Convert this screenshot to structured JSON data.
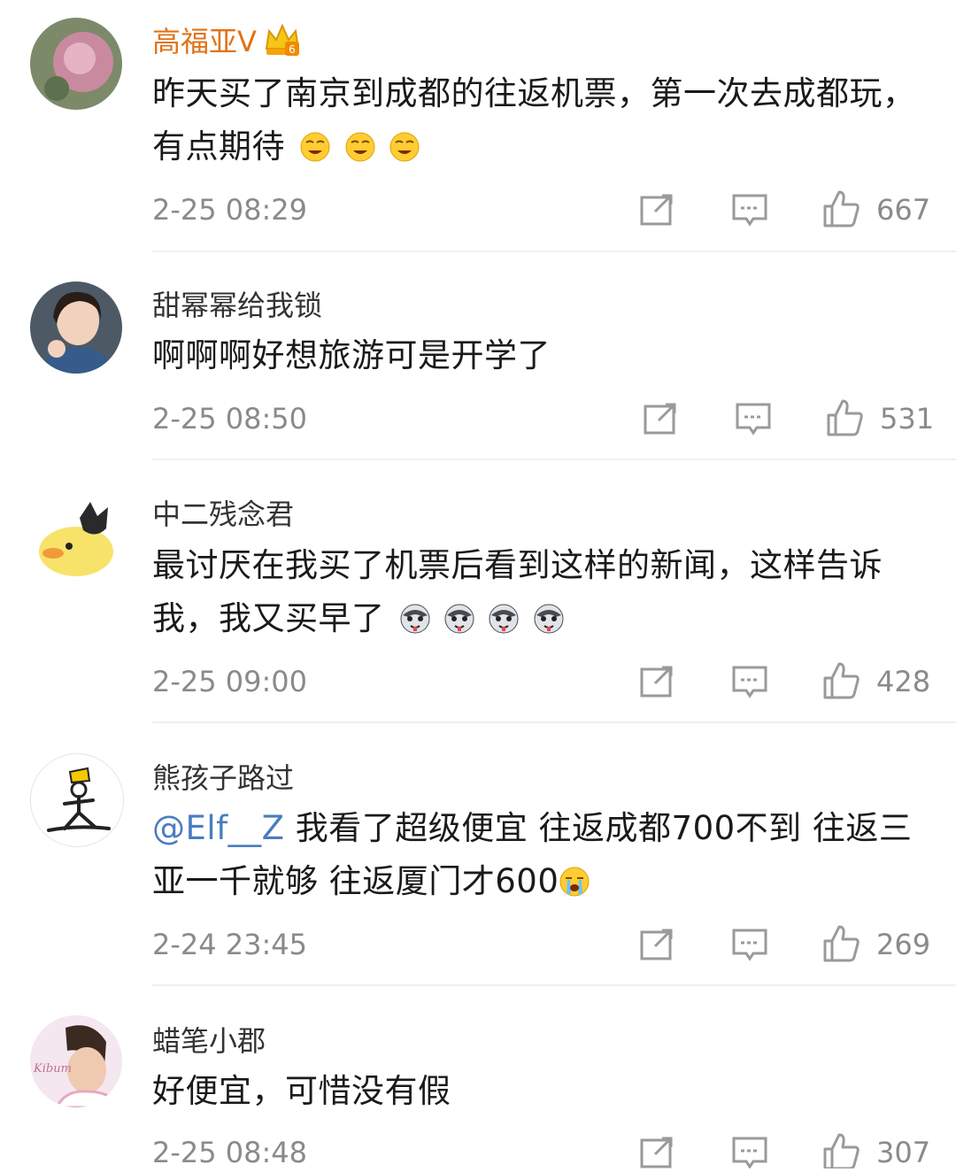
{
  "comments": [
    {
      "username": "高福亚V",
      "vip": true,
      "vip_badge_level": "6",
      "text": "昨天买了南京到成都的往返机票，第一次去成都玩，有点期待",
      "emoji": {
        "name": "smirk-emoji",
        "count": 3
      },
      "time": "2-25 08:29",
      "likes": "667"
    },
    {
      "username": "甜幂幂给我锁",
      "text": "啊啊啊好想旅游可是开学了",
      "time": "2-25 08:50",
      "likes": "531"
    },
    {
      "username": "中二残念君",
      "text": "最讨厌在我买了机票后看到这样的新闻，这样告诉我，我又买早了",
      "emoji": {
        "name": "husky-emoji",
        "count": 4
      },
      "time": "2-25 09:00",
      "likes": "428"
    },
    {
      "username": "熊孩子路过",
      "mention": "@Elf__Z",
      "text": " 我看了超级便宜 往返成都700不到 往返三亚一千就够 往返厦门才600",
      "emoji": {
        "name": "crying-emoji",
        "count": 1
      },
      "time": "2-24 23:45",
      "likes": "269"
    },
    {
      "username": "蜡笔小郡",
      "avatar_text": "Kibum",
      "text": "好便宜，可惜没有假",
      "time": "2-25 08:48",
      "likes": "307"
    }
  ],
  "icons": {
    "repost": "repost-icon",
    "comment": "comment-icon",
    "like": "thumbs-up-icon"
  },
  "colors": {
    "vip_name": "#e0731a",
    "mention": "#4a7dbf",
    "meta": "#8a8a8a"
  }
}
